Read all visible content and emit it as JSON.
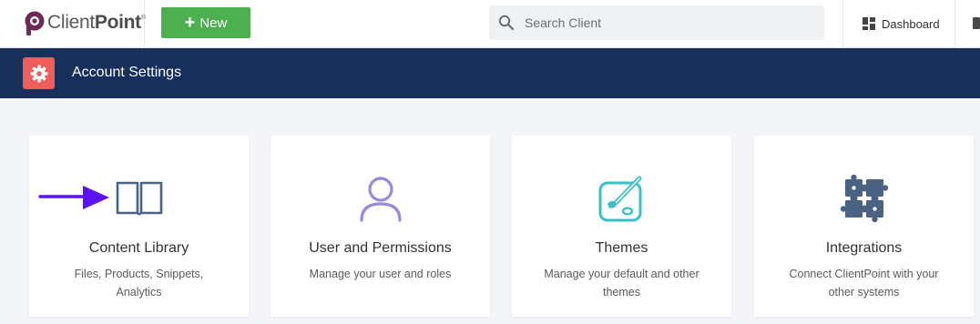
{
  "brand": {
    "name_light": "Client",
    "name_bold": "Point",
    "reg": "®"
  },
  "topbar": {
    "new_button": {
      "icon": "plus-icon",
      "label": "New"
    },
    "search": {
      "placeholder": "Search Client"
    },
    "dashboard": {
      "icon": "dashboard-grid-icon",
      "label": "Dashboard"
    }
  },
  "page_header": {
    "icon": "gear-icon",
    "title": "Account Settings"
  },
  "cards": [
    {
      "title": "Content Library",
      "description": "Files, Products, Snippets, Analytics",
      "icon": "book-icon",
      "icon_color": "#4a6382"
    },
    {
      "title": "User and Permissions",
      "description": "Manage your user and roles",
      "icon": "user-icon",
      "icon_color": "#9b8ad9"
    },
    {
      "title": "Themes",
      "description": "Manage your default and other themes",
      "icon": "palette-brush-icon",
      "icon_color": "#3cc0c6"
    },
    {
      "title": "Integrations",
      "description": "Connect ClientPoint with your other systems",
      "icon": "puzzle-icon",
      "icon_color": "#4a6382"
    }
  ],
  "colors": {
    "nav_band": "#16305b",
    "new_button": "#4caf50",
    "gear_tile": "#ee5e5a",
    "arrow": "#5b14f0"
  }
}
